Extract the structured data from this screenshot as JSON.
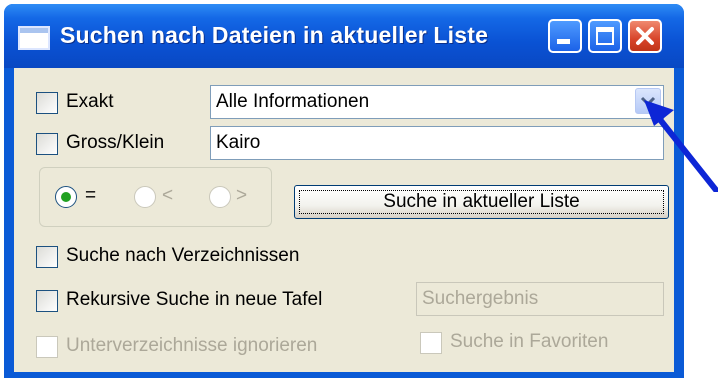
{
  "window": {
    "title": "Suchen nach Dateien in aktueller Liste",
    "controls": [
      "minimize-icon",
      "maximize-icon",
      "close-icon"
    ]
  },
  "options": {
    "exakt": {
      "label": "Exakt",
      "checked": false
    },
    "gross_klein": {
      "label": "Gross/Klein",
      "checked": false
    }
  },
  "scope_select": {
    "value": "Alle Informationen",
    "icon": "chevron-down-icon"
  },
  "search_input": {
    "value": "Kairo"
  },
  "compare": {
    "options": [
      {
        "label": "=",
        "selected": true,
        "enabled": true
      },
      {
        "label": "<",
        "selected": false,
        "enabled": false
      },
      {
        "label": ">",
        "selected": false,
        "enabled": false
      }
    ]
  },
  "search_button": {
    "label": "Suche in aktueller Liste"
  },
  "dir_search": {
    "label": "Suche nach Verzeichnissen",
    "checked": false
  },
  "recursive": {
    "label": "Rekursive Suche in neue Tafel",
    "checked": false
  },
  "result_name": {
    "value": "Suchergebnis"
  },
  "ignore_subdirs": {
    "label": "Unterverzeichnisse ignorieren",
    "checked": false,
    "enabled": false
  },
  "favorites": {
    "label": "Suche in Favoriten",
    "checked": false,
    "enabled": false
  },
  "colors": {
    "titlebar": "#0a52d4",
    "dialog_bg": "#ece9d8",
    "close_button": "#d8452a",
    "radio_dot": "#21a121",
    "pointer_arrow": "#0d26d6"
  }
}
